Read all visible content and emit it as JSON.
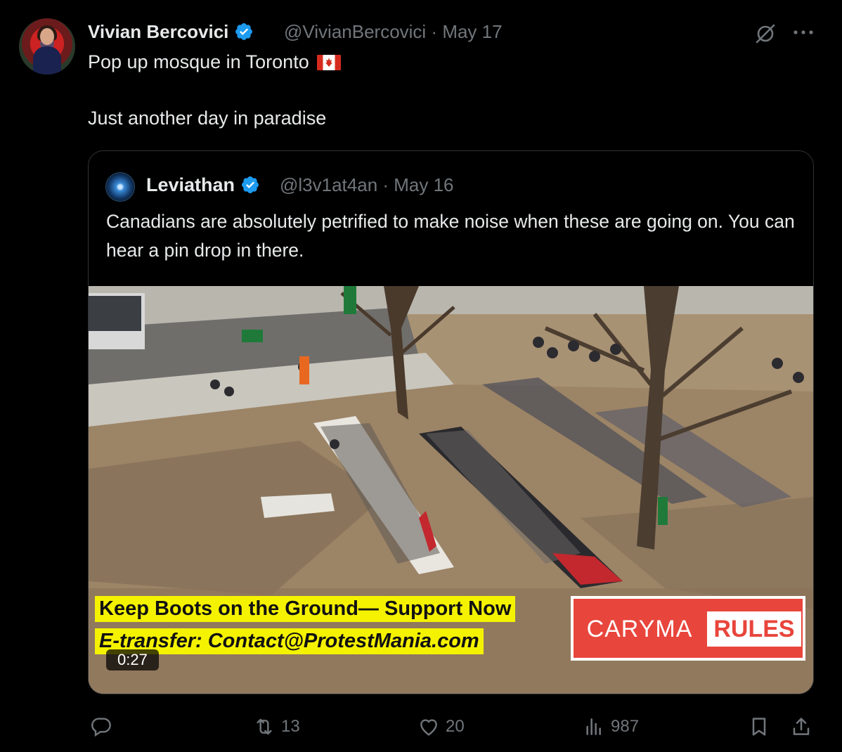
{
  "author": {
    "name": "Vivian Bercovici",
    "handle": "@VivianBercovici",
    "date": "May 17",
    "meta": "@VivianBercovici · May 17"
  },
  "tweet": {
    "line1": "Pop up mosque in Toronto",
    "line2": "Just another day in paradise"
  },
  "quote": {
    "name": "Leviathan",
    "meta": "@l3v1at4an · May 16",
    "text": "Canadians are absolutely petrified to make noise when these are going on. You can hear a pin drop in there.",
    "video": {
      "caption_line1": "Keep Boots on the Ground— Support Now",
      "caption_line2": "E-transfer: Contact@ProtestMania.com",
      "watermark_left": "CARYMA",
      "watermark_right": "RULES",
      "duration": "0:27"
    }
  },
  "actions": {
    "reply_count": "",
    "retweet_count": "13",
    "like_count": "20",
    "views_count": "987"
  },
  "icons": {
    "verified": "verified-badge-icon",
    "flag": "canada-flag-icon",
    "grok": "grok-icon",
    "more": "more-icon",
    "reply": "reply-icon",
    "retweet": "retweet-icon",
    "like": "heart-icon",
    "views": "views-icon",
    "bookmark": "bookmark-icon",
    "share": "share-icon"
  },
  "colors": {
    "background": "#000000",
    "text": "#e7e9ea",
    "secondary": "#71767b",
    "border": "#2f3336",
    "verified": "#1d9bf0",
    "caption": "#f5f200",
    "watermark": "#e8453c"
  }
}
